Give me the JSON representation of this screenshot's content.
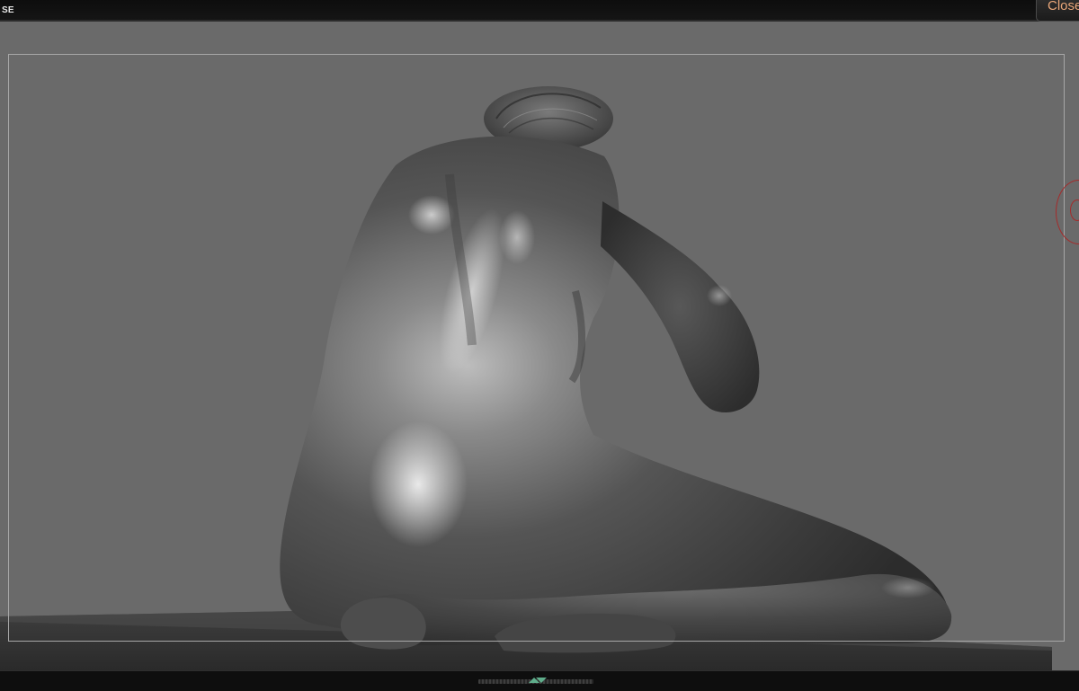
{
  "app": {
    "label": "SE"
  },
  "toolbar": {
    "close_label": "Close"
  },
  "viewport": {
    "background_color": "#6a6a6a",
    "frame_color": "#a7a7a7"
  },
  "colors": {
    "accent_orange": "#e8a679",
    "gizmo_red": "#a52b2b"
  },
  "icons": {
    "tray_toggle": "tray-toggle-arrows-icon",
    "gizmo": "navigation-gizmo-icon"
  }
}
